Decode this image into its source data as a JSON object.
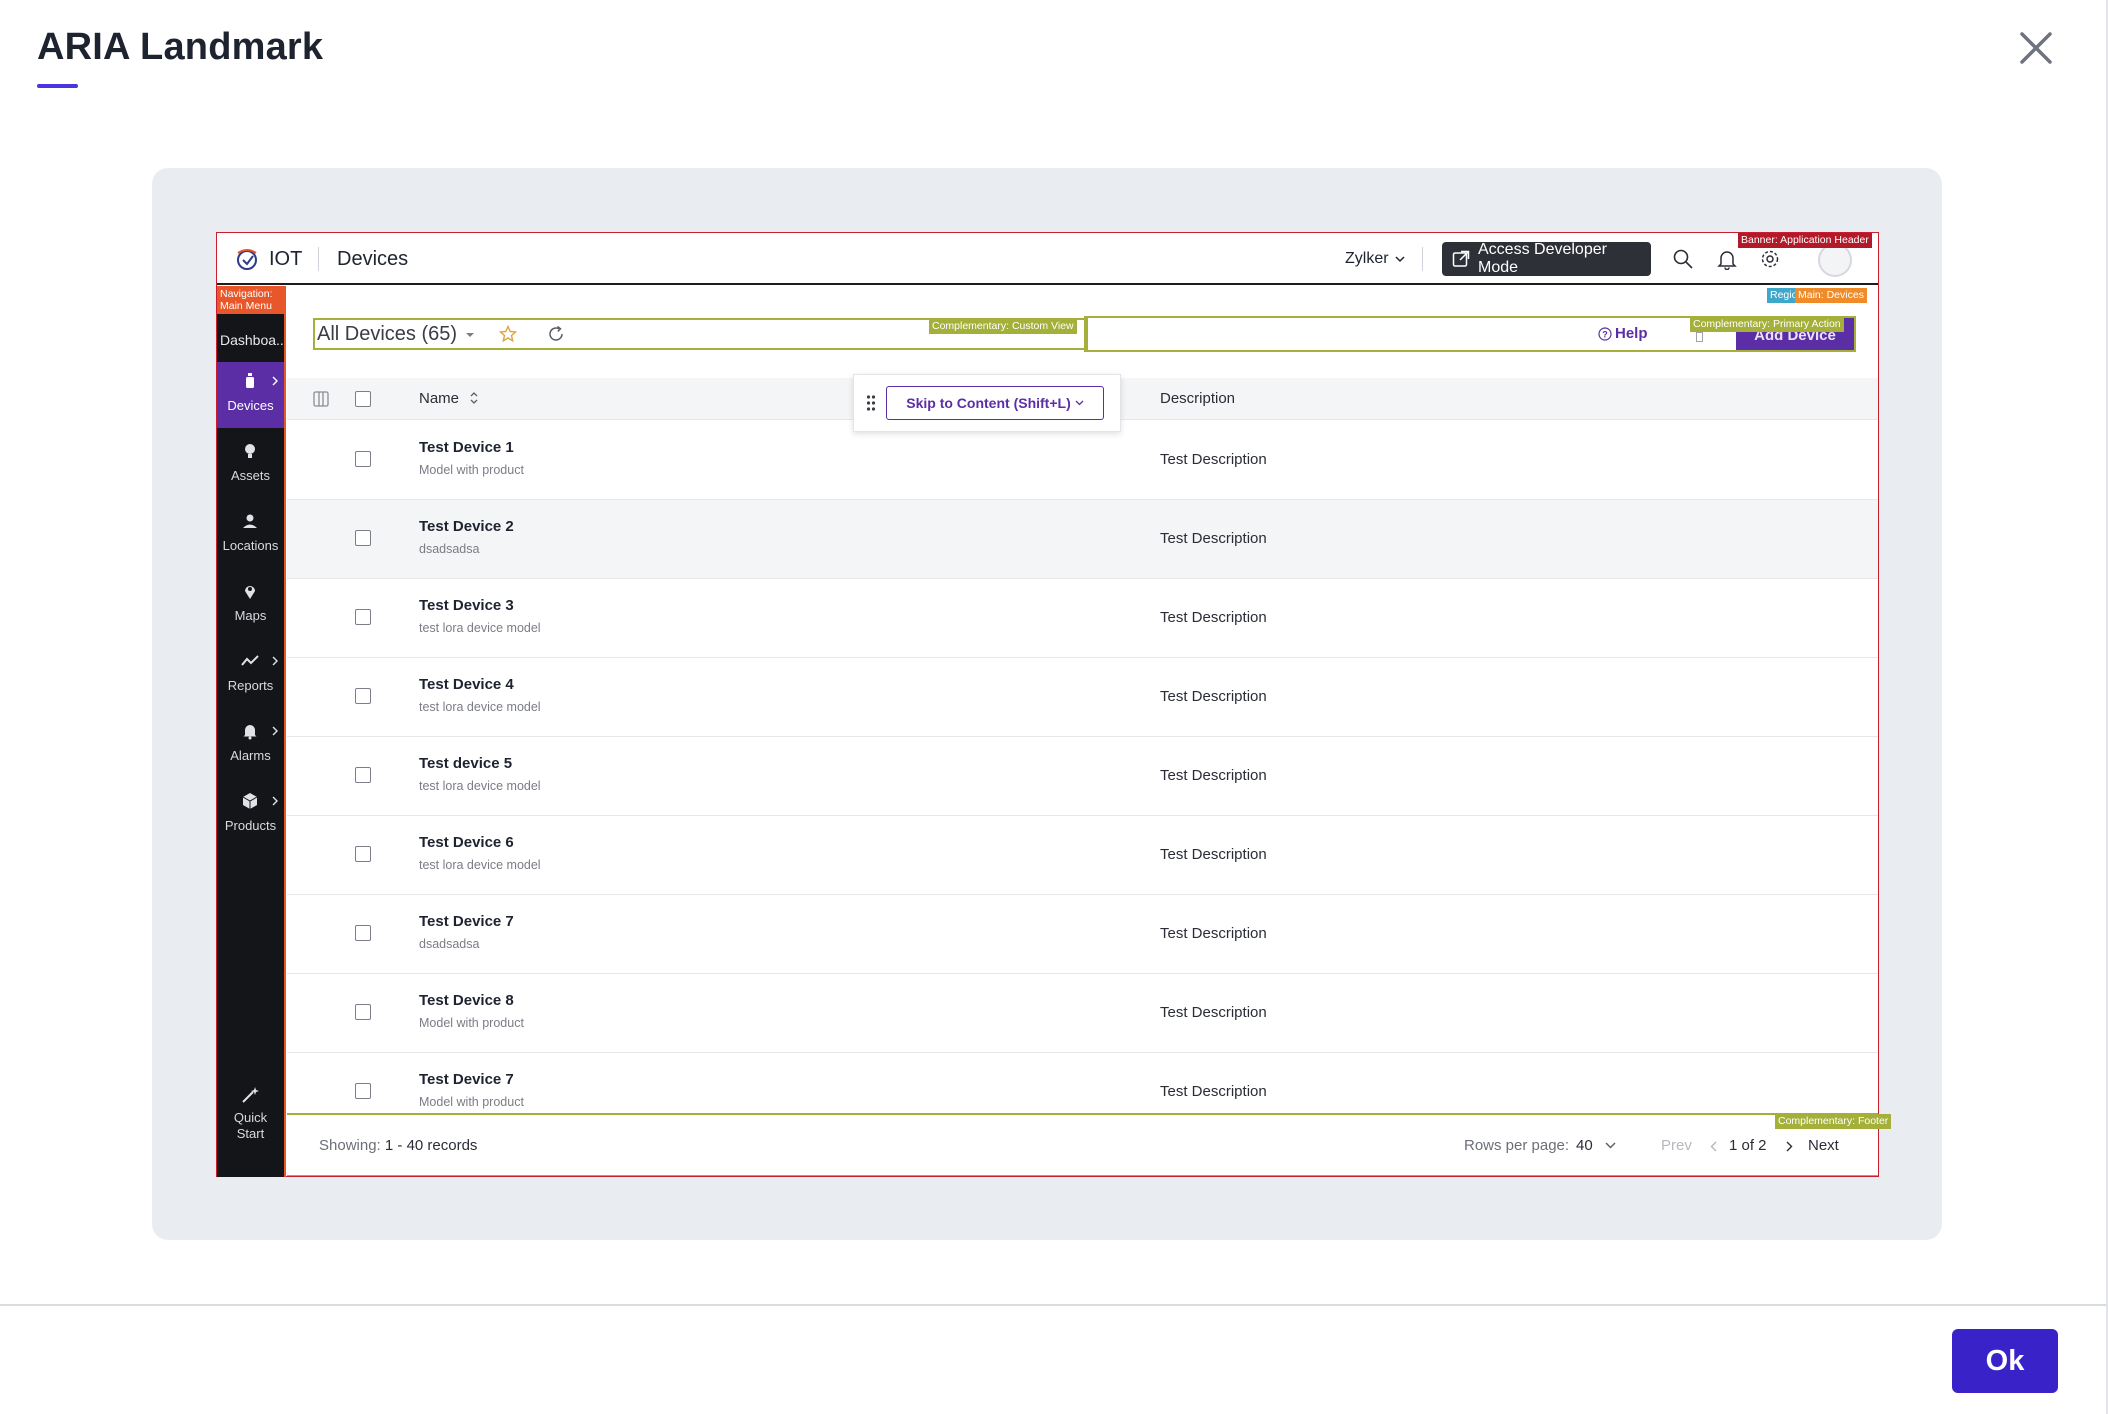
{
  "modal": {
    "title": "ARIA Landmark",
    "ok_label": "Ok",
    "accent_color": "#3a22c9"
  },
  "app": {
    "brand": "IOT",
    "page_name": "Devices",
    "org": "Zylker",
    "developer_button": "Access Developer Mode",
    "header_icons": [
      "search-icon",
      "bell-icon",
      "gear-icon"
    ]
  },
  "landmarks": {
    "banner": "Banner: Application Header",
    "region": "Region",
    "main": "Main: Devices",
    "navigation": "Navigation: Main Menu",
    "custom_view": "Complementary: Custom View",
    "primary_action": "Complementary: Primary Action",
    "footer": "Complementary: Footer"
  },
  "sidebar": {
    "dashboard": "Dashboa...",
    "items": [
      {
        "label": "Devices",
        "icon": "device-icon",
        "active": true,
        "chevron": true
      },
      {
        "label": "Assets",
        "icon": "bulb-icon",
        "active": false,
        "chevron": false
      },
      {
        "label": "Locations",
        "icon": "location-icon",
        "active": false,
        "chevron": false
      },
      {
        "label": "Maps",
        "icon": "map-pin-icon",
        "active": false,
        "chevron": false
      },
      {
        "label": "Reports",
        "icon": "chart-line-icon",
        "active": false,
        "chevron": true
      },
      {
        "label": "Alarms",
        "icon": "bell-icon",
        "active": false,
        "chevron": true
      },
      {
        "label": "Products",
        "icon": "box-icon",
        "active": false,
        "chevron": true
      }
    ],
    "quick_start_line1": "Quick",
    "quick_start_line2": "Start"
  },
  "toolbar": {
    "view_title": "All Devices (65)",
    "help_label": "Help",
    "add_button": "Add Device"
  },
  "table": {
    "col_name": "Name",
    "col_description": "Description",
    "rows": [
      {
        "name": "Test Device 1",
        "sub": "Model with product",
        "desc": "Test Description"
      },
      {
        "name": "Test Device 2",
        "sub": "dsadsadsa",
        "desc": "Test Description"
      },
      {
        "name": "Test Device 3",
        "sub": "test lora device model",
        "desc": "Test Description"
      },
      {
        "name": "Test Device 4",
        "sub": "test lora device model",
        "desc": "Test Description"
      },
      {
        "name": "Test device 5",
        "sub": "test lora device model",
        "desc": "Test Description"
      },
      {
        "name": "Test Device 6",
        "sub": "test lora device model",
        "desc": "Test Description"
      },
      {
        "name": "Test Device 7",
        "sub": "dsadsadsa",
        "desc": "Test Description"
      },
      {
        "name": "Test Device 8",
        "sub": "Model with product",
        "desc": "Test Description"
      },
      {
        "name": "Test Device 7",
        "sub": "Model with product",
        "desc": "Test Description"
      }
    ]
  },
  "skip": {
    "label": "Skip to Content (Shift+L)"
  },
  "pagination": {
    "showing_label": "Showing:",
    "showing_value": "1 - 40 records",
    "rows_per_page_label": "Rows per page:",
    "rows_per_page_value": "40",
    "prev": "Prev",
    "page_of": "1 of 2",
    "next": "Next"
  }
}
